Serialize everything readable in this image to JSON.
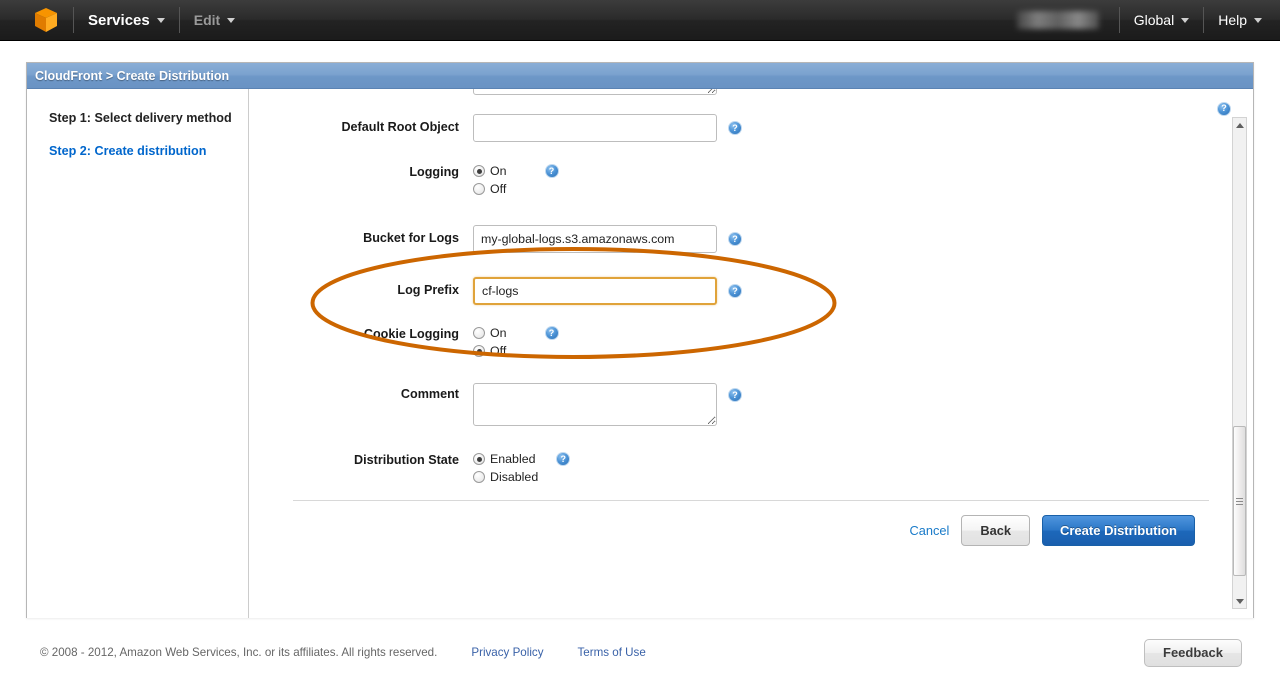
{
  "topnav": {
    "logo_icon": "aws-cube-icon",
    "services_label": "Services",
    "edit_label": "Edit",
    "region_label": "Global",
    "help_label": "Help",
    "account_label": ""
  },
  "panel": {
    "breadcrumb": "CloudFront > Create Distribution"
  },
  "sidebar": {
    "steps": [
      {
        "label": "Step 1: Select delivery method",
        "active": false
      },
      {
        "label": "Step 2: Create distribution",
        "active": true
      }
    ]
  },
  "form": {
    "fields": [
      {
        "label": "Default Root Object",
        "type": "text",
        "value": "",
        "help": "?"
      },
      {
        "label": "Logging",
        "type": "radio",
        "options": [
          "On",
          "Off"
        ],
        "selected": "On",
        "help": "?"
      },
      {
        "label": "Bucket for Logs",
        "type": "text",
        "value": "my-global-logs.s3.amazonaws.com",
        "help": "?"
      },
      {
        "label": "Log Prefix",
        "type": "text",
        "value": "cf-logs",
        "focused": true,
        "help": "?"
      },
      {
        "label": "Cookie Logging",
        "type": "radio",
        "options": [
          "On",
          "Off"
        ],
        "selected": "Off",
        "help": "?"
      },
      {
        "label": "Comment",
        "type": "textarea",
        "value": "",
        "help": "?"
      },
      {
        "label": "Distribution State",
        "type": "radio",
        "options": [
          "Enabled",
          "Disabled"
        ],
        "selected": "Enabled",
        "help": "?"
      }
    ]
  },
  "actions": {
    "cancel_label": "Cancel",
    "back_label": "Back",
    "submit_label": "Create Distribution"
  },
  "annotation": {
    "shape": "ellipse",
    "color": "#cc6600",
    "stroke_width": 4,
    "encircles": [
      "Bucket for Logs",
      "Log Prefix"
    ]
  },
  "footer": {
    "copyright": "© 2008 - 2012, Amazon Web Services, Inc. or its affiliates. All rights reserved.",
    "privacy_label": "Privacy Policy",
    "terms_label": "Terms of Use",
    "feedback_label": "Feedback"
  },
  "help_icon_glyph": "?",
  "colors": {
    "annotation_orange": "#cc6600",
    "primary_blue": "#1d68bb",
    "link_blue": "#0066cc",
    "panel_header_blue": "#6d97c7",
    "focus_orange": "#e0a33a"
  }
}
